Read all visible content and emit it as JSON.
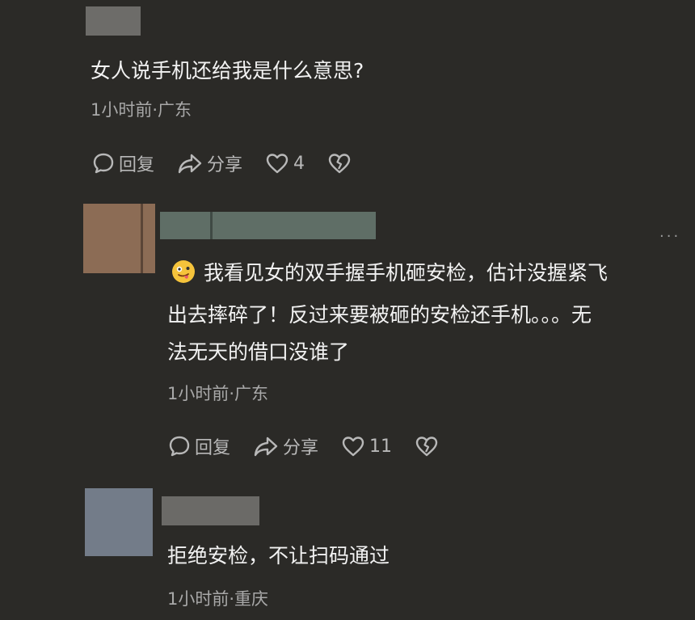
{
  "comment1": {
    "text": "女人说手机还给我是什么意思?",
    "meta": "1小时前·广东",
    "actions": {
      "reply": "回复",
      "share": "分享",
      "likes": "4"
    }
  },
  "comment2": {
    "text_lines": [
      "我看见女的双手握手机砸安检，估计没握紧飞",
      "出去摔碎了！反过来要被砸的安检还手机。。。无",
      "法无天的借口没谁了"
    ],
    "emoji": "silly-face-emoji",
    "meta": "1小时前·广东",
    "more": "···",
    "actions": {
      "reply": "回复",
      "share": "分享",
      "likes": "11"
    }
  },
  "comment3": {
    "text": "拒绝安检，不让扫码通过",
    "meta": "1小时前·重庆"
  },
  "colors": {
    "background": "#2b2a27",
    "text": "#f2f2f2",
    "meta": "#a8a8a8"
  }
}
